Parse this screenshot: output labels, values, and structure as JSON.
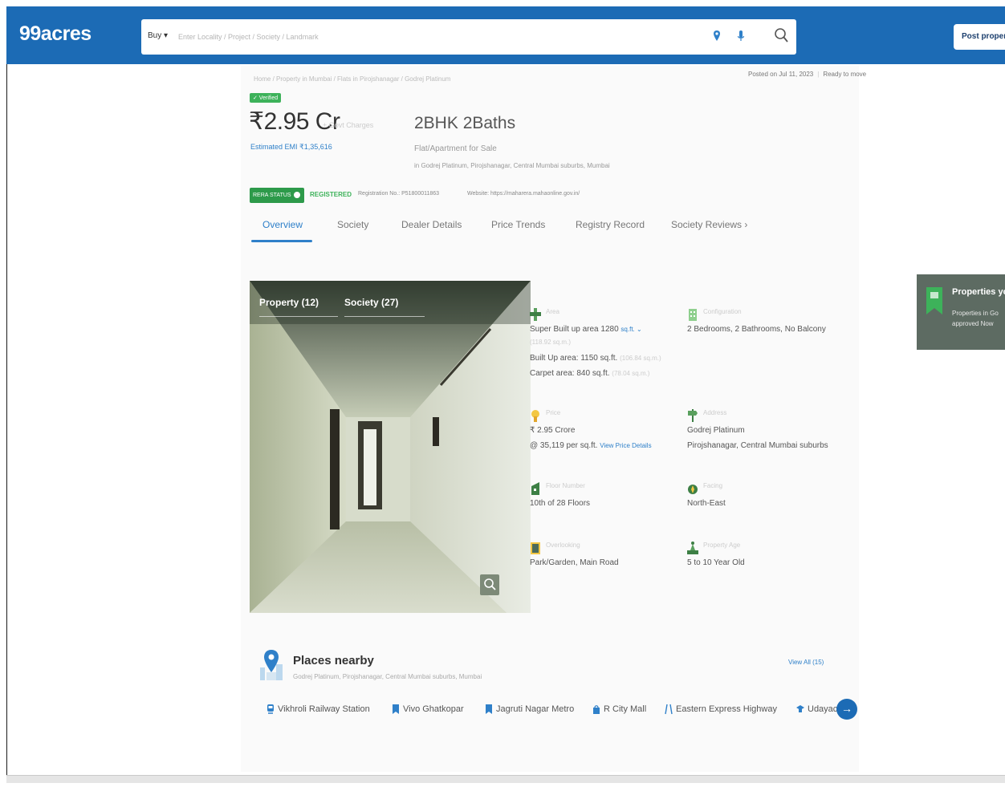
{
  "header": {
    "logo": "99acres",
    "buy_label": "Buy ▾",
    "search_placeholder": "Enter Locality / Project / Society / Landmark",
    "post_label": "Post property"
  },
  "listing": {
    "breadcrumb": "Home / Property in Mumbai / Flats in Pirojshanagar / Godrej Platinum",
    "posted_on": "Posted on Jul 11, 2023",
    "possession": "Ready to move",
    "verified": "✓ Verified",
    "price": "₹2.95 Cr",
    "price_faint": "+ Govt Charges",
    "emi": "Estimated EMI ₹1,35,616",
    "bhk": "2BHK 2Baths",
    "flat_type": "Flat/Apartment for Sale",
    "address": "in Godrej Platinum, Pirojshanagar, Central Mumbai suburbs, Mumbai",
    "rera_status": "RERA STATUS",
    "rera_registered": "REGISTERED",
    "registration": "Registration No.: P51800011863",
    "website": "Website: https://maharera.mahaonline.gov.in/"
  },
  "tabs": [
    "Overview",
    "Society",
    "Dealer Details",
    "Price Trends",
    "Registry Record",
    "Society Reviews  ›"
  ],
  "gallery": {
    "property_tab": "Property (12)",
    "society_tab": "Society (27)"
  },
  "details": {
    "area": {
      "label": "Area",
      "super_builtup": "Super Built up area 1280",
      "unit": "sq.ft. ⌄",
      "super_sub": "(118.92 sq.m.)",
      "builtup": "Built Up area: 1150 sq.ft.",
      "builtup_sub": "(106.84 sq.m.)",
      "carpet": "Carpet area: 840 sq.ft.",
      "carpet_sub": "(78.04 sq.m.)"
    },
    "config": {
      "label": "Configuration",
      "value": "2 Bedrooms, 2 Bathrooms, No Balcony"
    },
    "price": {
      "label": "Price",
      "value": "₹ 2.95 Crore",
      "per_sqft": "@ 35,119 per sq.ft.",
      "link": "View Price Details"
    },
    "address": {
      "label": "Address",
      "line1": "Godrej Platinum",
      "line2": "Pirojshanagar, Central Mumbai suburbs"
    },
    "floor": {
      "label": "Floor Number",
      "value": "10th  of 28 Floors"
    },
    "facing": {
      "label": "Facing",
      "value": "North-East"
    },
    "overlooking": {
      "label": "Overlooking",
      "value": "Park/Garden, Main Road"
    },
    "age": {
      "label": "Property Age",
      "value": "5 to 10 Year Old"
    }
  },
  "promo": {
    "title": "Properties you",
    "subtitle": "Properties in Go approved Now"
  },
  "places": {
    "title": "Places nearby",
    "subtitle": "Godrej Platinum, Pirojshanagar, Central Mumbai suburbs, Mumbai",
    "view_all": "View All (15)",
    "items": [
      "Vikhroli Railway Station",
      "Vivo Ghatkopar",
      "Jagruti Nagar Metro",
      "R City Mall",
      "Eastern Express Highway",
      "Udayachal"
    ]
  },
  "colors": {
    "brand": "#1c6bb5",
    "accent": "#2f80c9",
    "green": "#3db25a"
  }
}
